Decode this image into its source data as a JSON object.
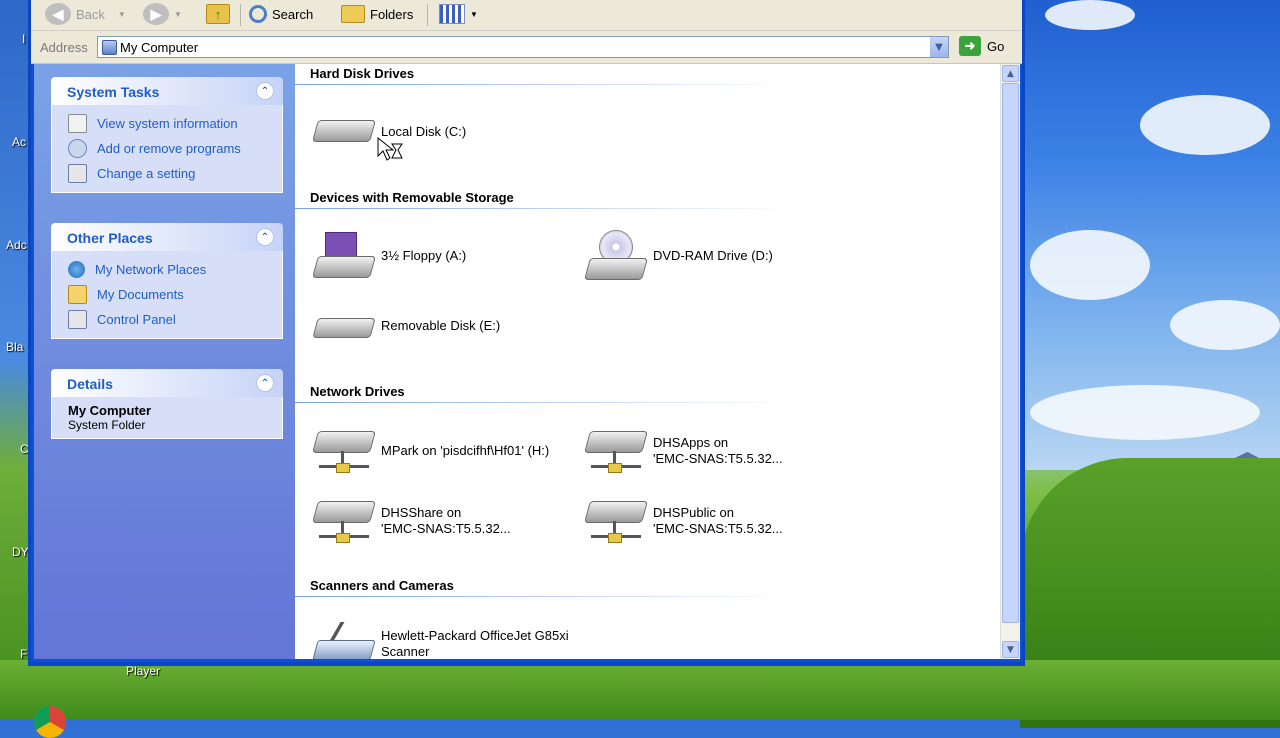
{
  "toolbar": {
    "back_label": "Back",
    "search_label": "Search",
    "folders_label": "Folders"
  },
  "address": {
    "label": "Address",
    "value": "My Computer",
    "go_label": "Go"
  },
  "taskpane": {
    "system_tasks": {
      "title": "System Tasks",
      "items": [
        "View system information",
        "Add or remove programs",
        "Change a setting"
      ]
    },
    "other_places": {
      "title": "Other Places",
      "items": [
        "My Network Places",
        "My Documents",
        "Control Panel"
      ]
    },
    "details": {
      "title": "Details",
      "name": "My Computer",
      "type": "System Folder"
    }
  },
  "groups": {
    "hard_disks": {
      "title": "Hard Disk Drives",
      "items": [
        "Local Disk (C:)"
      ]
    },
    "removable": {
      "title": "Devices with Removable Storage",
      "items": [
        "3½ Floppy (A:)",
        "DVD-RAM Drive (D:)",
        "Removable Disk (E:)"
      ]
    },
    "network": {
      "title": "Network Drives",
      "items": [
        "MPark on 'pisdcifhf\\Hf01' (H:)",
        "DHSApps on\n'EMC-SNAS:T5.5.32...",
        "DHSShare on\n'EMC-SNAS:T5.5.32...",
        "DHSPublic on\n'EMC-SNAS:T5.5.32..."
      ]
    },
    "scanners": {
      "title": "Scanners and Cameras",
      "items": [
        "Hewlett-Packard OfficeJet G85xi\nScanner"
      ]
    }
  },
  "desktop": {
    "labels": [
      "I",
      "Ac",
      "Adc",
      "Bla",
      "C",
      "DY",
      "F",
      "Player"
    ]
  },
  "colors": {
    "accent": "#215dc6",
    "window_frame": "#0a50d8",
    "taskpane_top": "#7ba2e7",
    "taskpane_bottom": "#6375d6"
  }
}
